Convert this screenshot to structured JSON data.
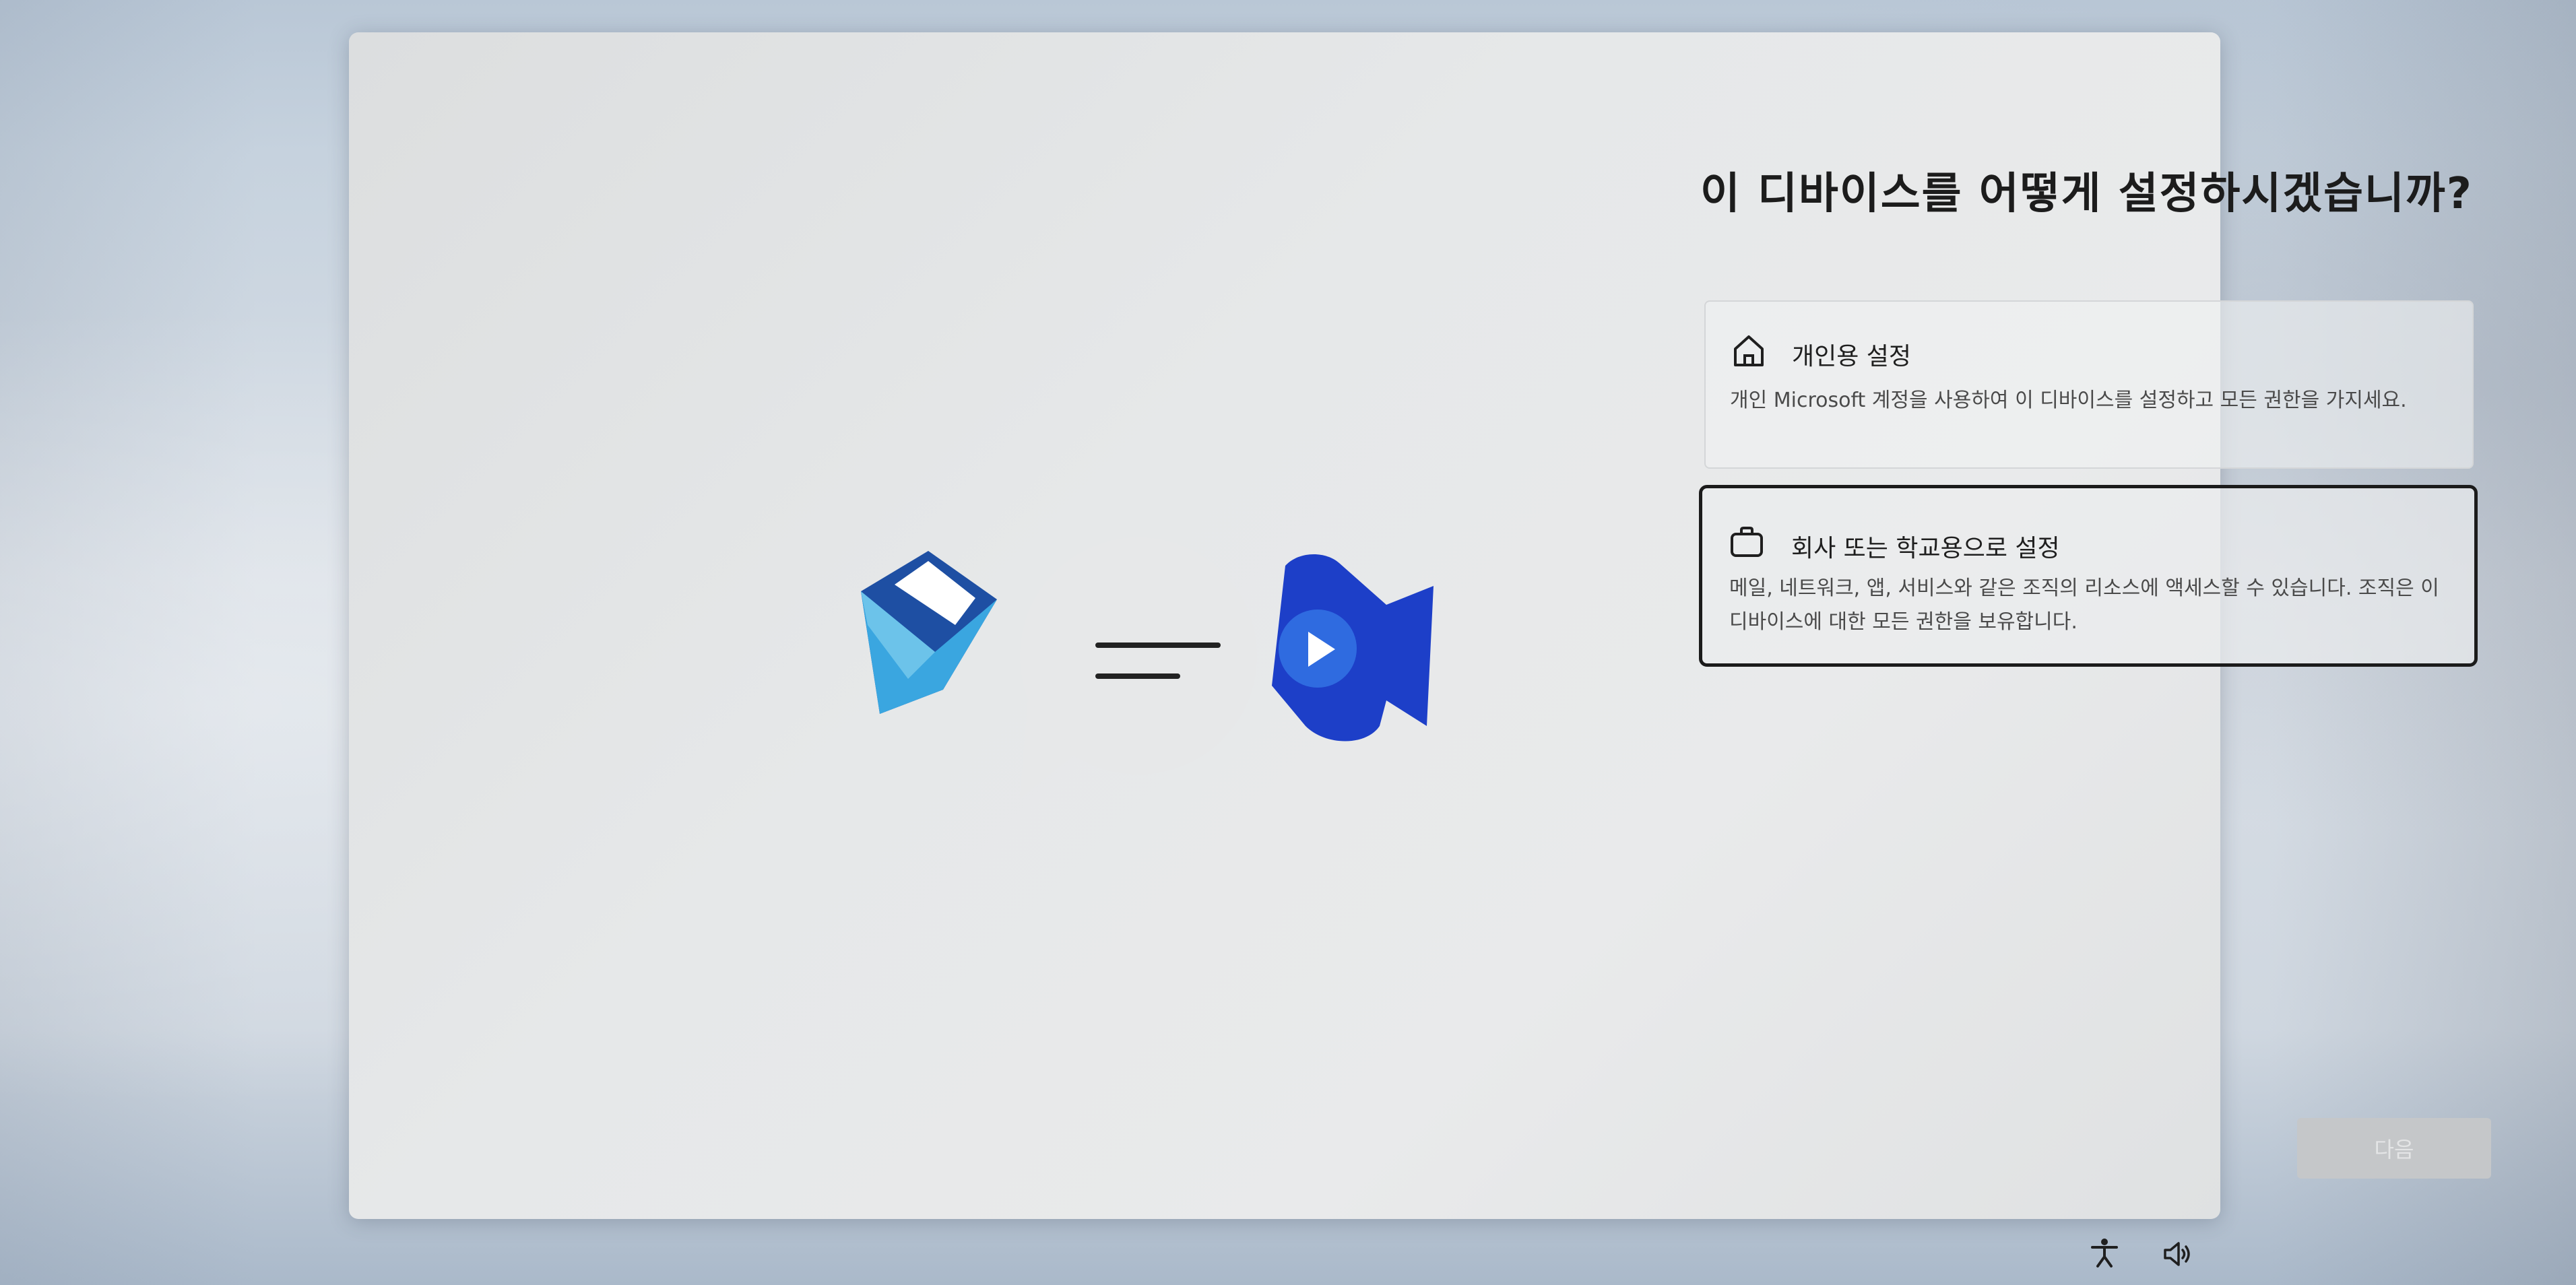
{
  "page": {
    "title": "이 디바이스를 어떻게 설정하시겠습니까?"
  },
  "options": [
    {
      "id": "personal",
      "icon": "home-icon",
      "title": "개인용 설정",
      "description": "개인 Microsoft 계정을 사용하여 이 디바이스를 설정하고 모든 권한을 가지세요.",
      "selected": false
    },
    {
      "id": "work",
      "icon": "briefcase-icon",
      "title": "회사 또는 학교용으로 설정",
      "description": "메일, 네트워크, 앱, 서비스와 같은 조직의 리소스에 액세스할 수 있습니다. 조직은 이 디바이스에 대한 모든 권한을 보유합니다.",
      "selected": true
    }
  ],
  "footer": {
    "next_label": "다음",
    "next_enabled": false
  },
  "illustration": {
    "icons": [
      "mail-icon",
      "chat-bubble-icon",
      "video-camera-icon"
    ]
  },
  "system_tray": {
    "icons": [
      "accessibility-icon",
      "volume-icon"
    ]
  },
  "colors": {
    "mail_dark": "#1e4fa3",
    "mail_light": "#3aa6e0",
    "video_blue": "#1d3fc8",
    "video_light": "#2f6be0",
    "selected_border": "#1b1b1b",
    "button_disabled": "#c5c7c9"
  }
}
